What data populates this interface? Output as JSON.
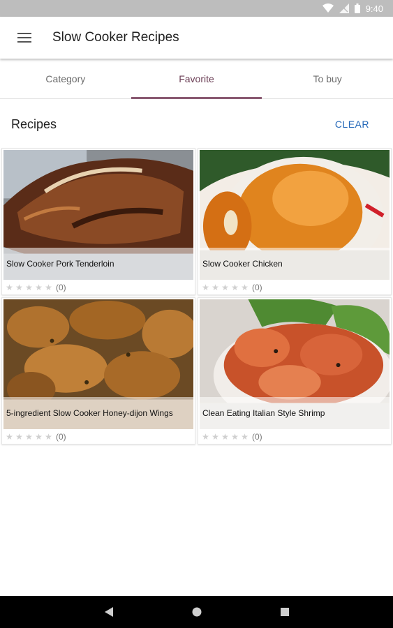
{
  "status_bar": {
    "time": "9:40"
  },
  "app_bar": {
    "title": "Slow Cooker Recipes"
  },
  "tabs": [
    {
      "label": "Category",
      "active": false
    },
    {
      "label": "Favorite",
      "active": true
    },
    {
      "label": "To buy",
      "active": false
    }
  ],
  "section": {
    "title": "Recipes",
    "clear_label": "CLEAR"
  },
  "recipes": [
    {
      "title": "Slow Cooker Pork Tenderloin",
      "rating_count": "(0)"
    },
    {
      "title": "Slow Cooker Chicken",
      "rating_count": "(0)"
    },
    {
      "title": "5-ingredient Slow Cooker Honey-dijon Wings",
      "rating_count": "(0)"
    },
    {
      "title": "Clean Eating Italian Style Shrimp",
      "rating_count": "(0)"
    }
  ],
  "colors": {
    "accent": "#8a5a72",
    "clear": "#2367b8",
    "status_bar": "#bdbdbd"
  }
}
